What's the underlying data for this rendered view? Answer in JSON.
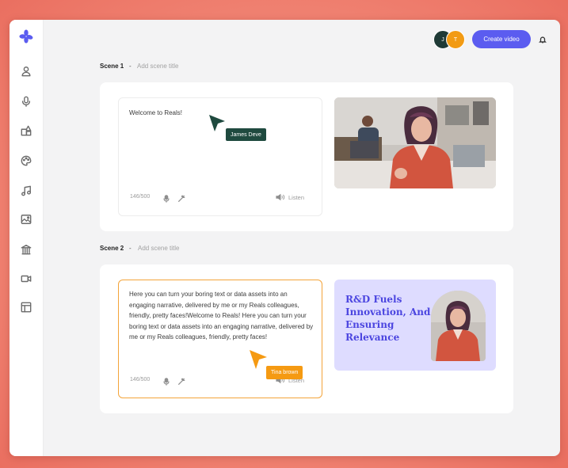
{
  "header": {
    "avatars": [
      {
        "initial": "J",
        "color": "#1f3a36"
      },
      {
        "initial": "T",
        "color": "#f29b14"
      }
    ],
    "create_button": "Create video",
    "bell_icon": "bell-icon"
  },
  "sidebar": {
    "logo": "reals-logo-icon",
    "items": [
      "user-icon",
      "microphone-icon",
      "shapes-icon",
      "palette-icon",
      "music-icon",
      "image-icon",
      "bank-icon",
      "video-icon",
      "layout-icon"
    ]
  },
  "scenes": [
    {
      "label": "Scene 1",
      "separator": "-",
      "title_placeholder": "Add scene title",
      "script_text": "Welcome to Reals!",
      "char_count": "146/500",
      "listen_label": "Listen",
      "cursor": {
        "name": "James Deve",
        "color": "#1f4a3f"
      }
    },
    {
      "label": "Scene 2",
      "separator": "-",
      "title_placeholder": "Add scene title",
      "script_text": "Here you can turn your boring text or data assets into an engaging narrative, delivered by me or my Reals colleagues, friendly, pretty faces!Welcome to Reals! Here you can turn your boring text or data assets into an engaging narrative, delivered by me or my Reals colleagues, friendly, pretty faces!",
      "char_count": "146/500",
      "listen_label": "Listen",
      "cursor": {
        "name": "Tina brown",
        "color": "#f59a12"
      },
      "slide_title": "R&D Fuels Innovation, And Ensuring Relevance"
    }
  ],
  "colors": {
    "accent": "#5b5cf0",
    "slide_text": "#4c46e0",
    "slide_bg": "#dedcff",
    "active_border": "#f4a43a"
  }
}
